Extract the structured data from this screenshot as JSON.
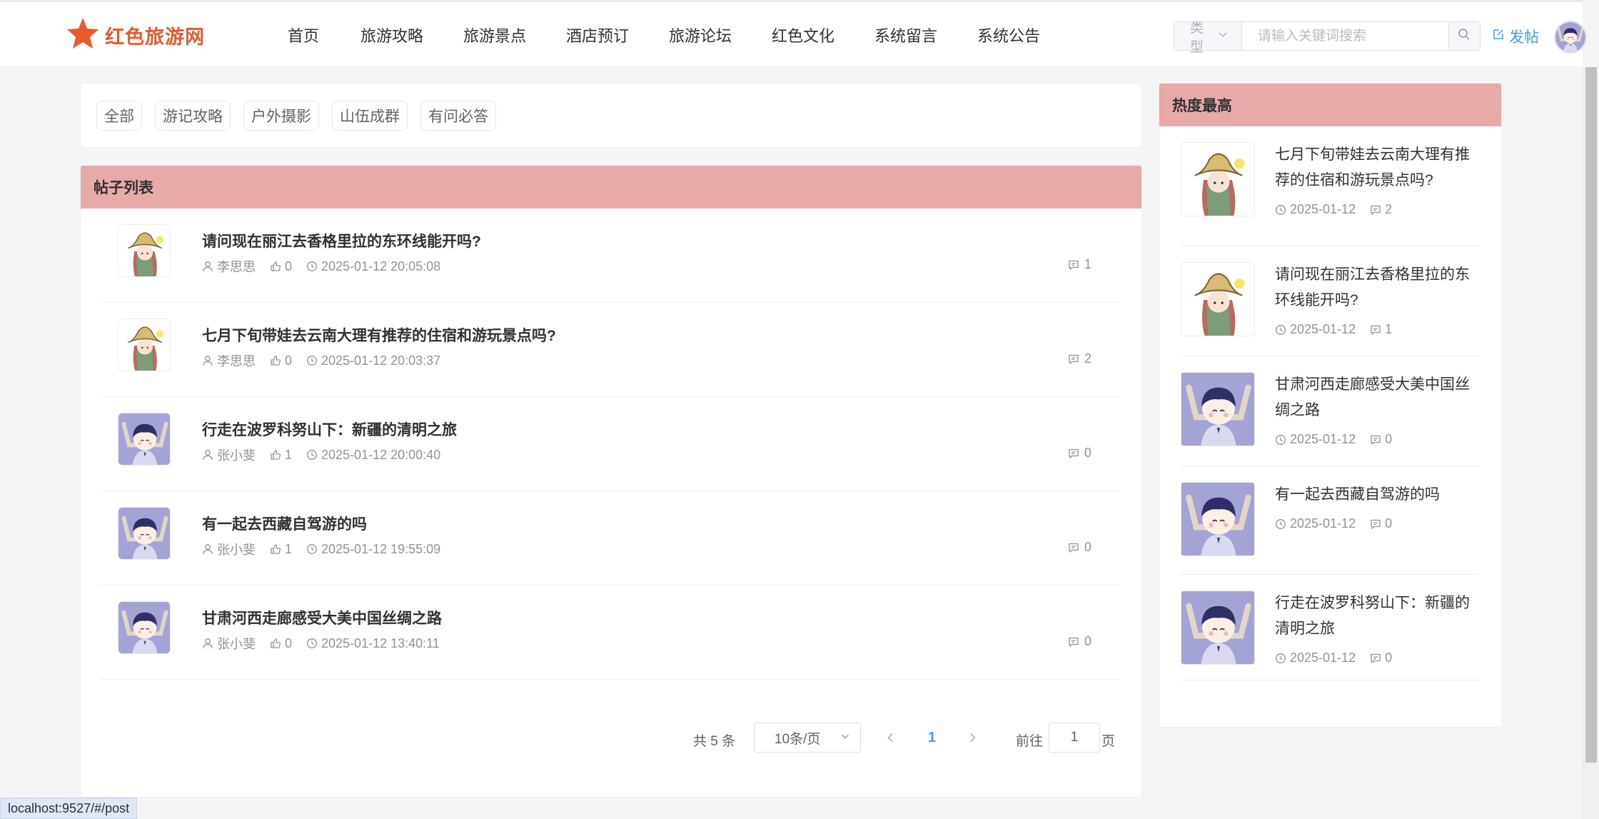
{
  "brand": {
    "name": "红色旅游网",
    "logo_color": "#e85a2b"
  },
  "nav": {
    "items": [
      {
        "label": "首页"
      },
      {
        "label": "旅游攻略"
      },
      {
        "label": "旅游景点"
      },
      {
        "label": "酒店预订"
      },
      {
        "label": "旅游论坛"
      },
      {
        "label": "红色文化"
      },
      {
        "label": "系统留言"
      },
      {
        "label": "系统公告"
      }
    ]
  },
  "search": {
    "type_placeholder": "类型",
    "input_placeholder": "请输入关键词搜索",
    "input_value": ""
  },
  "header": {
    "post_label": "发帖",
    "accent_color": "#409eff"
  },
  "filters": {
    "chips": [
      {
        "label": "全部"
      },
      {
        "label": "游记攻略"
      },
      {
        "label": "户外摄影"
      },
      {
        "label": "山伍成群"
      },
      {
        "label": "有问必答"
      }
    ]
  },
  "post_list": {
    "title": "帖子列表",
    "header_color": "#e8a9a9",
    "posts": [
      {
        "avatar": "hat-girl",
        "title": "请问现在丽江去香格里拉的东环线能开吗?",
        "author": "李思思",
        "likes": "0",
        "time": "2025-01-12 20:05:08",
        "comments": "1"
      },
      {
        "avatar": "hat-girl",
        "title": "七月下旬带娃去云南大理有推荐的住宿和游玩景点吗?",
        "author": "李思思",
        "likes": "0",
        "time": "2025-01-12 20:03:37",
        "comments": "2"
      },
      {
        "avatar": "purple-boy",
        "title": "行走在波罗科努山下：新疆的清明之旅",
        "author": "张小斐",
        "likes": "1",
        "time": "2025-01-12 20:00:40",
        "comments": "0"
      },
      {
        "avatar": "purple-boy",
        "title": "有一起去西藏自驾游的吗",
        "author": "张小斐",
        "likes": "1",
        "time": "2025-01-12 19:55:09",
        "comments": "0"
      },
      {
        "avatar": "purple-boy",
        "title": "甘肃河西走廊感受大美中国丝绸之路",
        "author": "张小斐",
        "likes": "0",
        "time": "2025-01-12 13:40:11",
        "comments": "0"
      }
    ]
  },
  "pagination": {
    "total_text": "共 5 条",
    "page_size": "10条/页",
    "current_page": "1",
    "goto_label": "前往",
    "goto_value": "1",
    "page_unit": "页"
  },
  "hot": {
    "title": "热度最高",
    "items": [
      {
        "avatar": "hat-girl",
        "title": "七月下旬带娃去云南大理有推荐的住宿和游玩景点吗?",
        "date": "2025-01-12",
        "comments": "2"
      },
      {
        "avatar": "hat-girl",
        "title": "请问现在丽江去香格里拉的东环线能开吗?",
        "date": "2025-01-12",
        "comments": "1"
      },
      {
        "avatar": "purple-boy",
        "title": "甘肃河西走廊感受大美中国丝绸之路",
        "date": "2025-01-12",
        "comments": "0"
      },
      {
        "avatar": "purple-boy",
        "title": "有一起去西藏自驾游的吗",
        "date": "2025-01-12",
        "comments": "0"
      },
      {
        "avatar": "purple-boy",
        "title": "行走在波罗科努山下：新疆的清明之旅",
        "date": "2025-01-12",
        "comments": "0"
      }
    ]
  },
  "status_bar": {
    "url": "localhost:9527/#/post"
  }
}
